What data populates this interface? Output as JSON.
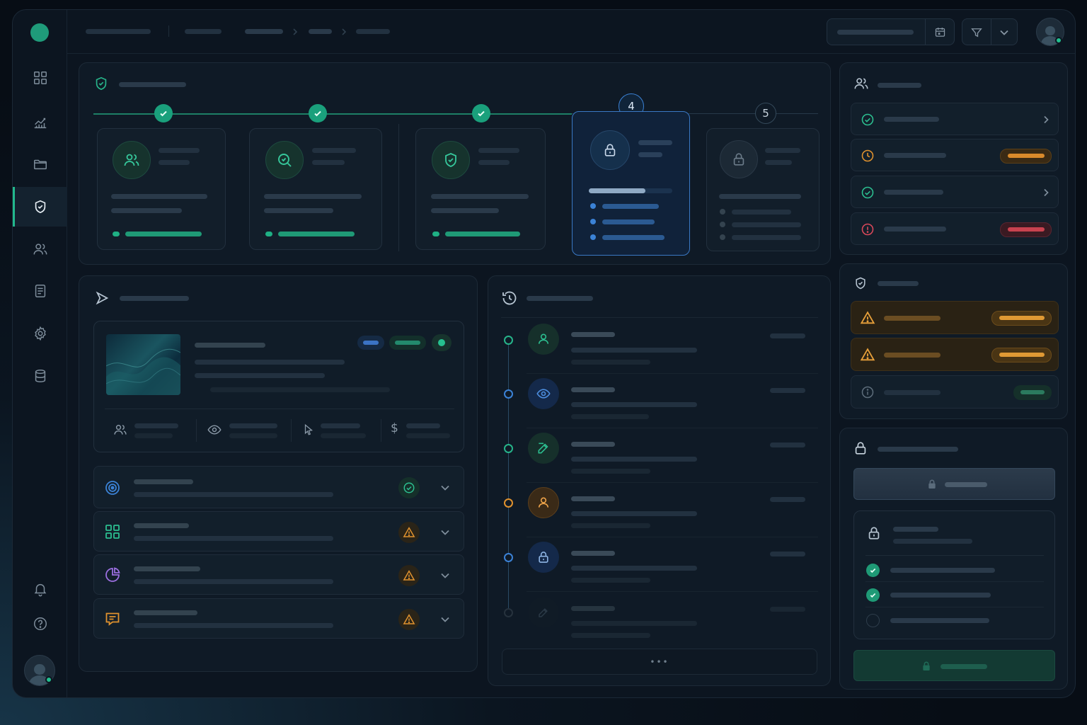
{
  "theme": {
    "accent": "#22b98d",
    "accent_dark": "#1aa07c",
    "blue": "#3b82d6",
    "orange": "#e0922e",
    "red": "#d9485a",
    "purple": "#9b6fe0",
    "panel": "#0f1a26"
  },
  "sidebar": {
    "items": [
      {
        "icon": "grid-icon",
        "active": false
      },
      {
        "icon": "chart-line-icon",
        "active": false
      },
      {
        "icon": "folder-icon",
        "active": false
      },
      {
        "icon": "shield-check-icon",
        "active": true
      },
      {
        "icon": "users-icon",
        "active": false
      },
      {
        "icon": "document-list-icon",
        "active": false
      },
      {
        "icon": "gear-icon",
        "active": false
      },
      {
        "icon": "database-icon",
        "active": false
      }
    ],
    "bottom": [
      "bell-icon",
      "help-icon"
    ]
  },
  "stepper": {
    "steps": [
      {
        "state": "complete",
        "icon": "users-icon",
        "progress": 1.0
      },
      {
        "state": "complete",
        "icon": "search-icon",
        "progress": 1.0
      },
      {
        "state": "complete",
        "icon": "shield-check-icon",
        "progress": 1.0
      },
      {
        "state": "current",
        "number": "4",
        "icon": "lock-icon",
        "progress": 0.68
      },
      {
        "state": "locked",
        "number": "5",
        "icon": "lock-icon",
        "progress": 0
      }
    ]
  },
  "preview": {
    "stats_icons": [
      "users-icon",
      "eye-icon",
      "cursor-icon",
      "dollar-icon"
    ],
    "dollar_glyph": "$"
  },
  "checks": [
    {
      "icon": "target-icon",
      "status": "ok"
    },
    {
      "icon": "grid-icon",
      "status": "warning"
    },
    {
      "icon": "pie-chart-icon",
      "status": "warning"
    },
    {
      "icon": "message-icon",
      "status": "warning"
    }
  ],
  "timeline": {
    "items": [
      {
        "icon": "user-icon",
        "color": "green"
      },
      {
        "icon": "eye-icon",
        "color": "blue"
      },
      {
        "icon": "edit-icon",
        "color": "green"
      },
      {
        "icon": "user-icon",
        "color": "orange"
      },
      {
        "icon": "lock-icon",
        "color": "blue"
      },
      {
        "icon": "edit-icon",
        "color": "muted"
      }
    ],
    "more_label": "•••"
  },
  "team": {
    "rows": [
      {
        "status": "ok"
      },
      {
        "status": "pending"
      },
      {
        "status": "ok"
      },
      {
        "status": "error"
      }
    ]
  },
  "alerts": {
    "rows": [
      {
        "level": "warning"
      },
      {
        "level": "warning"
      },
      {
        "level": "info"
      }
    ]
  },
  "security": {
    "checklist": [
      {
        "done": true
      },
      {
        "done": true
      },
      {
        "done": false
      }
    ]
  }
}
